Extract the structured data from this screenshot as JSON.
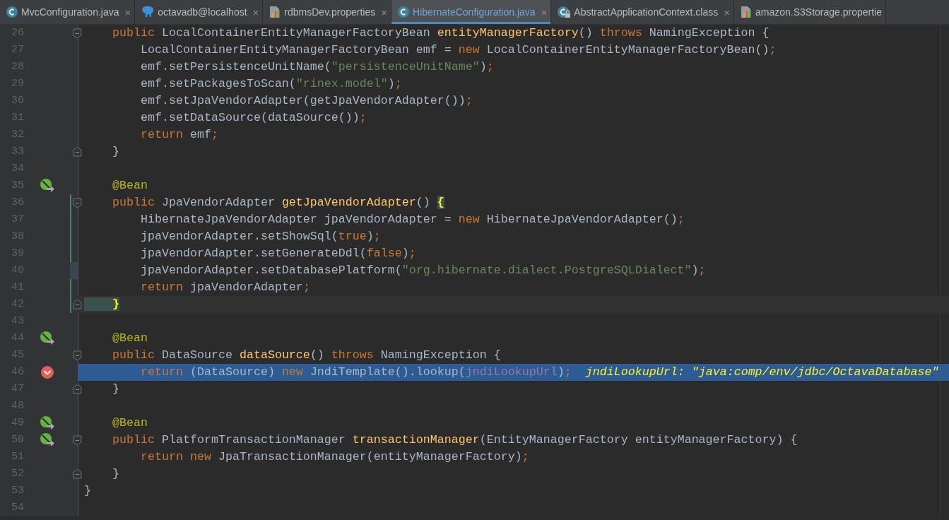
{
  "tabs": [
    {
      "label": "MvcConfiguration.java",
      "kind": "class",
      "selected": false,
      "close": "×"
    },
    {
      "label": "octavadb@localhost",
      "kind": "database",
      "selected": false,
      "close": "×"
    },
    {
      "label": "rdbmsDev.properties",
      "kind": "properties",
      "selected": false,
      "close": "×"
    },
    {
      "label": "HibernateConfiguration.java",
      "kind": "class",
      "selected": true,
      "close": "×"
    },
    {
      "label": "AbstractApplicationContext.class",
      "kind": "locked",
      "selected": false,
      "close": "×"
    },
    {
      "label": "amazon.S3Storage.propertie",
      "kind": "properties",
      "selected": false
    }
  ],
  "lines": [
    {
      "number": "26",
      "fold_start": true,
      "segments": [
        {
          "kind": "keyword",
          "text": "    public "
        },
        {
          "kind": "plain",
          "text": "LocalContainerEntityManagerFactoryBean "
        },
        {
          "kind": "method",
          "text": "entityManagerFactory"
        },
        {
          "kind": "plain",
          "text": "() "
        },
        {
          "kind": "keyword",
          "text": "throws "
        },
        {
          "kind": "plain",
          "text": "NamingException {"
        }
      ]
    },
    {
      "number": "27",
      "segments": [
        {
          "kind": "plain",
          "text": "        LocalContainerEntityManagerFactoryBean emf = "
        },
        {
          "kind": "keyword",
          "text": "new "
        },
        {
          "kind": "plain",
          "text": "LocalContainerEntityManagerFactoryBean()"
        },
        {
          "kind": "keyword",
          "text": ";"
        }
      ]
    },
    {
      "number": "28",
      "segments": [
        {
          "kind": "plain",
          "text": "        emf.setPersistenceUnitName("
        },
        {
          "kind": "string",
          "text": "\"persistenceUnitName\""
        },
        {
          "kind": "plain",
          "text": ")"
        },
        {
          "kind": "keyword",
          "text": ";"
        }
      ]
    },
    {
      "number": "29",
      "segments": [
        {
          "kind": "plain",
          "text": "        emf.setPackagesToScan("
        },
        {
          "kind": "string",
          "text": "\"rinex.model\""
        },
        {
          "kind": "plain",
          "text": ")"
        },
        {
          "kind": "keyword",
          "text": ";"
        }
      ]
    },
    {
      "number": "30",
      "segments": [
        {
          "kind": "plain",
          "text": "        emf.setJpaVendorAdapter(getJpaVendorAdapter())"
        },
        {
          "kind": "keyword",
          "text": ";"
        }
      ]
    },
    {
      "number": "31",
      "segments": [
        {
          "kind": "plain",
          "text": "        emf.setDataSource(dataSource())"
        },
        {
          "kind": "keyword",
          "text": ";"
        }
      ]
    },
    {
      "number": "32",
      "segments": [
        {
          "kind": "keyword",
          "text": "        return "
        },
        {
          "kind": "plain",
          "text": "emf"
        },
        {
          "kind": "keyword",
          "text": ";"
        }
      ]
    },
    {
      "number": "33",
      "fold_end": true,
      "segments": [
        {
          "kind": "plain",
          "text": "    }"
        }
      ]
    },
    {
      "number": "34"
    },
    {
      "number": "35",
      "bean": true,
      "segments": [
        {
          "kind": "annotation",
          "text": "    @Bean"
        }
      ]
    },
    {
      "number": "36",
      "fold_start": true,
      "added": true,
      "segments": [
        {
          "kind": "keyword",
          "text": "    public "
        },
        {
          "kind": "plain",
          "text": "JpaVendorAdapter "
        },
        {
          "kind": "method",
          "text": "getJpaVendorAdapter"
        },
        {
          "kind": "plain",
          "text": "() "
        },
        {
          "kind": "brace",
          "text": "{"
        }
      ]
    },
    {
      "number": "37",
      "added": true,
      "segments": [
        {
          "kind": "plain",
          "text": "        HibernateJpaVendorAdapter jpaVendorAdapter = "
        },
        {
          "kind": "keyword",
          "text": "new "
        },
        {
          "kind": "plain",
          "text": "HibernateJpaVendorAdapter()"
        },
        {
          "kind": "keyword",
          "text": ";"
        }
      ]
    },
    {
      "number": "38",
      "added": true,
      "segments": [
        {
          "kind": "plain",
          "text": "        jpaVendorAdapter.setShowSql("
        },
        {
          "kind": "keyword",
          "text": "true"
        },
        {
          "kind": "plain",
          "text": ")"
        },
        {
          "kind": "keyword",
          "text": ";"
        }
      ]
    },
    {
      "number": "39",
      "added": true,
      "segments": [
        {
          "kind": "plain",
          "text": "        jpaVendorAdapter.setGenerateDdl("
        },
        {
          "kind": "keyword",
          "text": "false"
        },
        {
          "kind": "plain",
          "text": ")"
        },
        {
          "kind": "keyword",
          "text": ";"
        }
      ]
    },
    {
      "number": "40",
      "modified": true,
      "segments": [
        {
          "kind": "plain",
          "text": "        jpaVendorAdapter.setDatabasePlatform("
        },
        {
          "kind": "string",
          "text": "\"org.hibernate.dialect.PostgreSQLDialect\""
        },
        {
          "kind": "plain",
          "text": ")"
        },
        {
          "kind": "keyword",
          "text": ";"
        }
      ]
    },
    {
      "number": "41",
      "added": true,
      "segments": [
        {
          "kind": "keyword",
          "text": "        return "
        },
        {
          "kind": "plain",
          "text": "jpaVendorAdapter"
        },
        {
          "kind": "keyword",
          "text": ";"
        }
      ]
    },
    {
      "number": "42",
      "fold_end": true,
      "added": true,
      "current": true,
      "segments": [
        {
          "kind": "brace",
          "text": "    }"
        }
      ]
    },
    {
      "number": "43"
    },
    {
      "number": "44",
      "bean": true,
      "segments": [
        {
          "kind": "annotation",
          "text": "    @Bean"
        }
      ]
    },
    {
      "number": "45",
      "fold_start": true,
      "segments": [
        {
          "kind": "keyword",
          "text": "    public "
        },
        {
          "kind": "plain",
          "text": "DataSource "
        },
        {
          "kind": "method",
          "text": "dataSource"
        },
        {
          "kind": "plain",
          "text": "() "
        },
        {
          "kind": "keyword",
          "text": "throws "
        },
        {
          "kind": "plain",
          "text": "NamingException {"
        }
      ]
    },
    {
      "number": "46",
      "breakpoint": true,
      "selected": true,
      "segments": [
        {
          "kind": "keyword",
          "text": "        return "
        },
        {
          "kind": "plain",
          "text": "(DataSource) "
        },
        {
          "kind": "keyword",
          "text": "new "
        },
        {
          "kind": "plain",
          "text": "JndiTemplate().lookup("
        },
        {
          "kind": "field",
          "text": "jndiLookupUrl"
        },
        {
          "kind": "plain",
          "text": ")"
        },
        {
          "kind": "keyword",
          "text": ";"
        }
      ],
      "hint": "jndiLookupUrl: \"java:comp/env/jdbc/OctavaDatabase\""
    },
    {
      "number": "47",
      "fold_end": true,
      "segments": [
        {
          "kind": "plain",
          "text": "    }"
        }
      ]
    },
    {
      "number": "48"
    },
    {
      "number": "49",
      "bean": true,
      "segments": [
        {
          "kind": "annotation",
          "text": "    @Bean"
        }
      ]
    },
    {
      "number": "50",
      "bean": true,
      "fold_start": true,
      "segments": [
        {
          "kind": "keyword",
          "text": "    public "
        },
        {
          "kind": "plain",
          "text": "PlatformTransactionManager "
        },
        {
          "kind": "method",
          "text": "transactionManager"
        },
        {
          "kind": "plain",
          "text": "(EntityManagerFactory entityManagerFactory) {"
        }
      ]
    },
    {
      "number": "51",
      "segments": [
        {
          "kind": "keyword",
          "text": "        return new "
        },
        {
          "kind": "plain",
          "text": "JpaTransactionManager(entityManagerFactory)"
        },
        {
          "kind": "keyword",
          "text": ";"
        }
      ]
    },
    {
      "number": "52",
      "fold_end": true,
      "segments": [
        {
          "kind": "plain",
          "text": "    }"
        }
      ]
    },
    {
      "number": "53",
      "segments": [
        {
          "kind": "plain",
          "text": "}"
        }
      ]
    },
    {
      "number": "54"
    }
  ]
}
